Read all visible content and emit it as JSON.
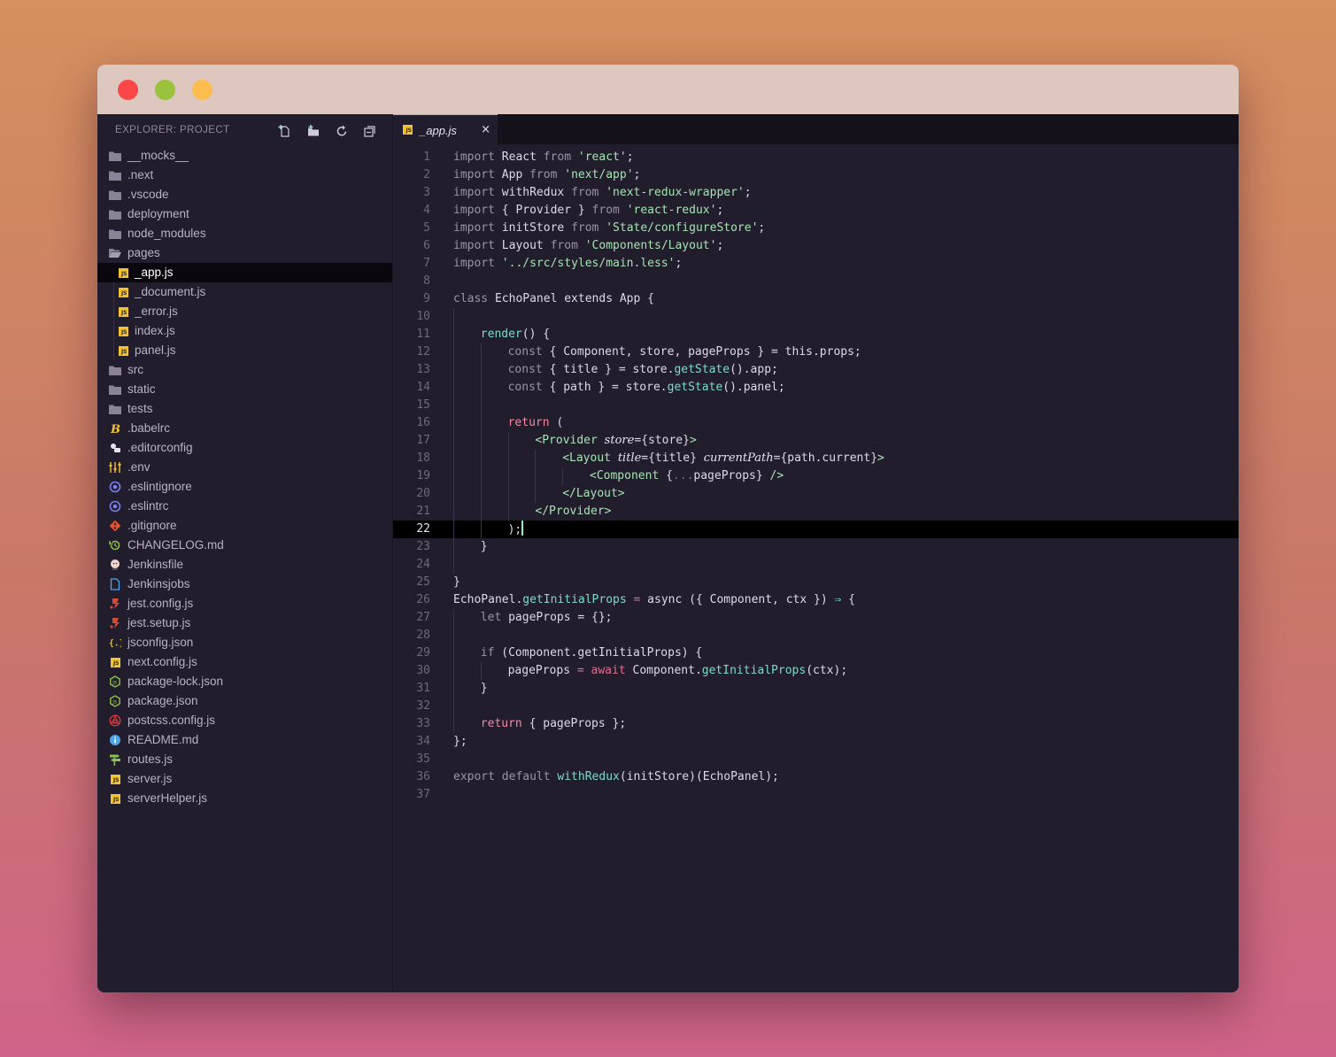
{
  "window": {
    "traffic_lights": [
      "close",
      "minimize",
      "zoom"
    ]
  },
  "sidebar": {
    "title": "EXPLORER: PROJECT",
    "actions": [
      "new-file-icon",
      "new-folder-icon",
      "refresh-icon",
      "collapse-all-icon"
    ],
    "items": [
      {
        "label": "__mocks__",
        "icon": "folder-icon",
        "depth": 0
      },
      {
        "label": ".next",
        "icon": "folder-icon",
        "depth": 0
      },
      {
        "label": ".vscode",
        "icon": "folder-icon",
        "depth": 0
      },
      {
        "label": "deployment",
        "icon": "folder-icon",
        "depth": 0
      },
      {
        "label": "node_modules",
        "icon": "folder-icon",
        "depth": 0
      },
      {
        "label": "pages",
        "icon": "folder-open-icon",
        "depth": 0
      },
      {
        "label": "_app.js",
        "icon": "js-file-icon",
        "depth": 1,
        "selected": true
      },
      {
        "label": "_document.js",
        "icon": "js-file-icon",
        "depth": 1
      },
      {
        "label": "_error.js",
        "icon": "js-file-icon",
        "depth": 1
      },
      {
        "label": "index.js",
        "icon": "js-file-icon",
        "depth": 1
      },
      {
        "label": "panel.js",
        "icon": "js-file-icon",
        "depth": 1
      },
      {
        "label": "src",
        "icon": "folder-icon",
        "depth": 0
      },
      {
        "label": "static",
        "icon": "folder-icon",
        "depth": 0
      },
      {
        "label": "tests",
        "icon": "folder-icon",
        "depth": 0
      },
      {
        "label": ".babelrc",
        "icon": "babel-icon",
        "depth": 0
      },
      {
        "label": ".editorconfig",
        "icon": "editorconfig-icon",
        "depth": 0
      },
      {
        "label": ".env",
        "icon": "env-icon",
        "depth": 0
      },
      {
        "label": ".eslintignore",
        "icon": "eslint-icon",
        "depth": 0
      },
      {
        "label": ".eslintrc",
        "icon": "eslint-icon",
        "depth": 0
      },
      {
        "label": ".gitignore",
        "icon": "git-icon",
        "depth": 0
      },
      {
        "label": "CHANGELOG.md",
        "icon": "changelog-icon",
        "depth": 0
      },
      {
        "label": "Jenkinsfile",
        "icon": "jenkins-icon",
        "depth": 0
      },
      {
        "label": "Jenkinsjobs",
        "icon": "document-icon",
        "depth": 0
      },
      {
        "label": "jest.config.js",
        "icon": "jest-icon",
        "depth": 0
      },
      {
        "label": "jest.setup.js",
        "icon": "jest-icon",
        "depth": 0
      },
      {
        "label": "jsconfig.json",
        "icon": "json-icon",
        "depth": 0
      },
      {
        "label": "next.config.js",
        "icon": "js-file-icon",
        "depth": 0
      },
      {
        "label": "package-lock.json",
        "icon": "nodejs-icon",
        "depth": 0
      },
      {
        "label": "package.json",
        "icon": "nodejs-icon",
        "depth": 0
      },
      {
        "label": "postcss.config.js",
        "icon": "postcss-icon",
        "depth": 0
      },
      {
        "label": "README.md",
        "icon": "info-icon",
        "depth": 0
      },
      {
        "label": "routes.js",
        "icon": "routes-icon",
        "depth": 0
      },
      {
        "label": "server.js",
        "icon": "js-file-icon",
        "depth": 0
      },
      {
        "label": "serverHelper.js",
        "icon": "js-file-icon",
        "depth": 0
      }
    ]
  },
  "editor": {
    "tab": {
      "label": "_app.js",
      "icon": "js-file-icon",
      "close": "×"
    },
    "active_line": 22,
    "lines": [
      {
        "n": "1",
        "indent": 0,
        "tokens": [
          [
            "kw",
            "import"
          ],
          [
            "",
            "React "
          ],
          [
            "kw",
            "from"
          ],
          [
            "str",
            "'react'"
          ],
          [
            "",
            ";"
          ]
        ]
      },
      {
        "n": "2",
        "indent": 0,
        "tokens": [
          [
            "kw",
            "import"
          ],
          [
            "",
            "App "
          ],
          [
            "kw",
            "from"
          ],
          [
            "str",
            "'next/app'"
          ],
          [
            "",
            ";"
          ]
        ]
      },
      {
        "n": "3",
        "indent": 0,
        "tokens": [
          [
            "kw",
            "import"
          ],
          [
            "",
            "withRedux "
          ],
          [
            "kw",
            "from"
          ],
          [
            "str",
            "'next-redux-wrapper'"
          ],
          [
            "",
            ";"
          ]
        ]
      },
      {
        "n": "4",
        "indent": 0,
        "tokens": [
          [
            "kw",
            "import"
          ],
          [
            "",
            "{ Provider } "
          ],
          [
            "kw",
            "from"
          ],
          [
            "str",
            "'react-redux'"
          ],
          [
            "",
            ";"
          ]
        ]
      },
      {
        "n": "5",
        "indent": 0,
        "tokens": [
          [
            "kw",
            "import"
          ],
          [
            "",
            "initStore "
          ],
          [
            "kw",
            "from"
          ],
          [
            "str",
            "'State/configureStore'"
          ],
          [
            "",
            ";"
          ]
        ]
      },
      {
        "n": "6",
        "indent": 0,
        "tokens": [
          [
            "kw",
            "import"
          ],
          [
            "",
            "Layout "
          ],
          [
            "kw",
            "from"
          ],
          [
            "str",
            "'Components/Layout'"
          ],
          [
            "",
            ";"
          ]
        ]
      },
      {
        "n": "7",
        "indent": 0,
        "tokens": [
          [
            "kw",
            "import"
          ],
          [
            "str",
            "'../src/styles/main.less'"
          ],
          [
            "",
            ";"
          ]
        ]
      },
      {
        "n": "8",
        "indent": 0,
        "tokens": []
      },
      {
        "n": "9",
        "indent": 0,
        "tokens": [
          [
            "kw",
            "class "
          ],
          [
            "",
            "EchoPanel extends App {"
          ]
        ]
      },
      {
        "n": "10",
        "indent": 1,
        "tokens": []
      },
      {
        "n": "11",
        "indent": 1,
        "tokens": [
          [
            "fn",
            "render"
          ],
          [
            "",
            "() {"
          ]
        ]
      },
      {
        "n": "12",
        "indent": 2,
        "tokens": [
          [
            "kw",
            "const "
          ],
          [
            "",
            "{ Component, store, pageProps } = this.props;"
          ]
        ]
      },
      {
        "n": "13",
        "indent": 2,
        "tokens": [
          [
            "kw",
            "const "
          ],
          [
            "",
            "{ title } = store."
          ],
          [
            "fn",
            "getState"
          ],
          [
            "",
            "().app;"
          ]
        ]
      },
      {
        "n": "14",
        "indent": 2,
        "tokens": [
          [
            "kw",
            "const "
          ],
          [
            "",
            "{ path } = store."
          ],
          [
            "fn",
            "getState"
          ],
          [
            "",
            "().panel;"
          ]
        ]
      },
      {
        "n": "15",
        "indent": 2,
        "tokens": []
      },
      {
        "n": "16",
        "indent": 2,
        "tokens": [
          [
            "ret",
            "return "
          ],
          [
            "",
            "("
          ]
        ]
      },
      {
        "n": "17",
        "indent": 3,
        "tokens": [
          [
            "tag",
            "<Provider "
          ],
          [
            "attr",
            "store"
          ],
          [
            "",
            "={store}"
          ],
          [
            "tag",
            ">"
          ]
        ]
      },
      {
        "n": "18",
        "indent": 4,
        "tokens": [
          [
            "tag",
            "<Layout "
          ],
          [
            "attr",
            "title"
          ],
          [
            "",
            "={title} "
          ],
          [
            "attr",
            "currentPath"
          ],
          [
            "",
            "={path.current}"
          ],
          [
            "tag",
            ">"
          ]
        ]
      },
      {
        "n": "19",
        "indent": 5,
        "tokens": [
          [
            "tag",
            "<Component "
          ],
          [
            "",
            "{"
          ],
          [
            "spr",
            "..."
          ],
          [
            "",
            "pageProps} "
          ],
          [
            "tag",
            "/>"
          ]
        ]
      },
      {
        "n": "20",
        "indent": 4,
        "tokens": [
          [
            "tag",
            "</Layout>"
          ]
        ]
      },
      {
        "n": "21",
        "indent": 3,
        "tokens": [
          [
            "tag",
            "</Provider>"
          ]
        ]
      },
      {
        "n": "22",
        "indent": 2,
        "tokens": [
          [
            "",
            ");"
          ]
        ],
        "cursor": true
      },
      {
        "n": "23",
        "indent": 1,
        "tokens": [
          [
            "",
            "}"
          ]
        ]
      },
      {
        "n": "24",
        "indent": 1,
        "tokens": []
      },
      {
        "n": "25",
        "indent": 0,
        "tokens": [
          [
            "",
            "}"
          ]
        ]
      },
      {
        "n": "26",
        "indent": 0,
        "tokens": [
          [
            "",
            "EchoPanel."
          ],
          [
            "fn",
            "getInitialProps"
          ],
          [
            "op",
            " = "
          ],
          [
            "",
            "async ({ Component, ctx }) "
          ],
          [
            "fn",
            "⇒"
          ],
          [
            "",
            " {"
          ]
        ]
      },
      {
        "n": "27",
        "indent": 1,
        "tokens": [
          [
            "kw",
            "let "
          ],
          [
            "",
            "pageProps = {};"
          ]
        ]
      },
      {
        "n": "28",
        "indent": 1,
        "tokens": []
      },
      {
        "n": "29",
        "indent": 1,
        "tokens": [
          [
            "kw",
            "if "
          ],
          [
            "",
            "(Component.getInitialProps) {"
          ]
        ]
      },
      {
        "n": "30",
        "indent": 2,
        "tokens": [
          [
            "",
            "pageProps "
          ],
          [
            "op",
            "= await "
          ],
          [
            "",
            "Component."
          ],
          [
            "fn",
            "getInitialProps"
          ],
          [
            "",
            "(ctx);"
          ]
        ]
      },
      {
        "n": "31",
        "indent": 1,
        "tokens": [
          [
            "",
            "}"
          ]
        ]
      },
      {
        "n": "32",
        "indent": 1,
        "tokens": []
      },
      {
        "n": "33",
        "indent": 1,
        "tokens": [
          [
            "ret",
            "return "
          ],
          [
            "",
            "{ pageProps };"
          ]
        ]
      },
      {
        "n": "34",
        "indent": 0,
        "tokens": [
          [
            "",
            "};"
          ]
        ]
      },
      {
        "n": "35",
        "indent": 0,
        "tokens": []
      },
      {
        "n": "36",
        "indent": 0,
        "tokens": [
          [
            "kw",
            "export default "
          ],
          [
            "fn",
            "withRedux"
          ],
          [
            "",
            "(initStore)(EchoPanel);"
          ]
        ]
      },
      {
        "n": "37",
        "indent": 0,
        "tokens": []
      }
    ]
  },
  "colors": {
    "background_top": "#d4905e",
    "background_bottom": "#cf6389",
    "titlebar": "#ddc7be",
    "editor_bg": "#221d2d",
    "selection": "#0a070e",
    "accent": "#6fd4c4"
  }
}
